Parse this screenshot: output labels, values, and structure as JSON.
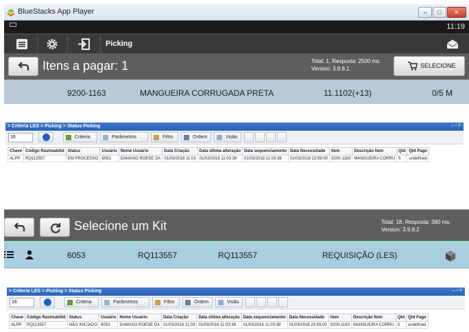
{
  "panel1": {
    "window_title": "BlueStacks App Player",
    "window_buttons": [
      "–",
      "□",
      "✕"
    ],
    "clock": "11:19",
    "toolbar_title": "Picking",
    "header_title": "Itens a pagar: 1",
    "status_line1": "Total: 1. Resposta: 2500 ms.",
    "status_line2": "Version: 3.9.8.1",
    "select_label": "SELECIONE",
    "row": {
      "code": "9200-1163",
      "description": "MANGUEIRA CORRUGADA PRETA",
      "quantity": "11.1102(+13)",
      "progress": "0/5 M"
    }
  },
  "grid1": {
    "breadcrumb": "> Criteria LES > Picking > Status Picking",
    "page_size": "16",
    "buttons": [
      "Criteria",
      "Parâmetros",
      "Filtro",
      "Ordem",
      "Visão"
    ],
    "columns": [
      "Chave",
      "Código Rastreabilid",
      "Status",
      "Usuário",
      "Nome Usuário",
      "Data Criação",
      "Data última alteração",
      "Data sequenciamento",
      "Data Necessidade",
      "Item",
      "Descrição Item",
      "Qtd",
      "Qtd Pago"
    ],
    "rows": [
      [
        "ALPP",
        "RQ113557",
        "EM PROCESSO",
        "6053",
        "DAMASO ROESE DA",
        "01/03/2018 11:03",
        "01/03/2018 11:03:38",
        "01/03/2018 11:03:38",
        "01/03/2018 23:59:00",
        "9200-1163",
        "MANGUEIRA CORRU",
        "5",
        "undefined"
      ]
    ]
  },
  "panel3": {
    "header_title": "Selecione um Kit",
    "status_line1": "Total: 18. Resposta: 380 ms.",
    "status_line2": "Version: 3.9.8.2",
    "row": {
      "user": "6053",
      "code1": "RQ113557",
      "code2": "RQ113557",
      "type": "REQUISIÇÃO (LES)"
    }
  },
  "grid2": {
    "breadcrumb": "> Criteria LES > Picking > Status Picking",
    "page_size": "16",
    "buttons": [
      "Criteria",
      "Parâmetros",
      "Filtro",
      "Ordem",
      "Visão"
    ],
    "columns": [
      "Chave",
      "Código Rastreabilid",
      "Status",
      "Usuário",
      "Nome Usuário",
      "Data Criação",
      "Data última alteração",
      "Data sequenciamento",
      "Data Necessidade",
      "Item",
      "Descrição Item",
      "Qtd",
      "Qtd Pago"
    ],
    "rows": [
      [
        "ALPP",
        "RQ113557",
        "NÃO INICIADO",
        "6053",
        "DAMASO ROESE DA",
        "01/03/2018 11:03",
        "01/03/2018 11:03:38",
        "01/03/2018 11:03:38",
        "01/03/2018 23:59:00",
        "9200-1163",
        "MANGUEIRA CORRU",
        "5",
        "undefined"
      ]
    ]
  },
  "colors": {
    "header_gray": "#5e5e5e",
    "row_blue_1": "#b9cad6",
    "row_blue_2": "#a9cee0",
    "grid_header_blue": "#2e62b3"
  }
}
